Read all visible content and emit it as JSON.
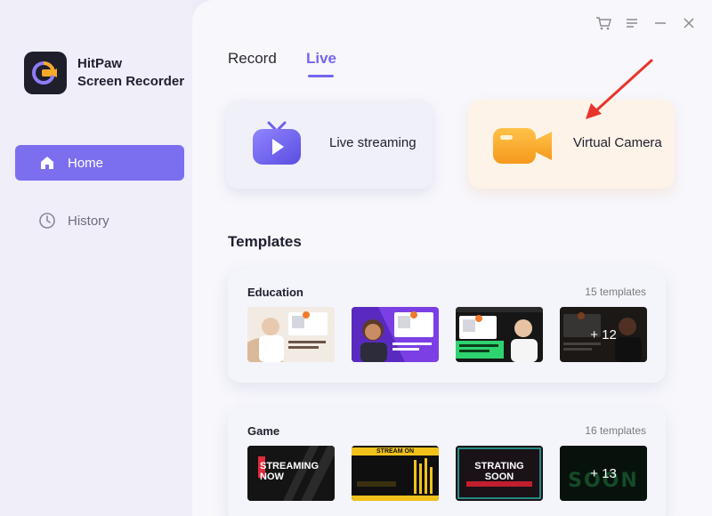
{
  "app": {
    "name_line1": "HitPaw",
    "name_line2": "Screen Recorder"
  },
  "sidebar": {
    "items": [
      {
        "label": "Home",
        "icon": "home-icon",
        "active": true
      },
      {
        "label": "History",
        "icon": "clock-icon",
        "active": false
      }
    ]
  },
  "tabs": [
    {
      "label": "Record",
      "active": false
    },
    {
      "label": "Live",
      "active": true
    }
  ],
  "modes": [
    {
      "label": "Live streaming",
      "icon": "tv-play-icon"
    },
    {
      "label": "Virtual Camera",
      "icon": "video-camera-icon"
    }
  ],
  "templates": {
    "title": "Templates",
    "categories": [
      {
        "name": "Education",
        "count": "15 templates",
        "thumbs": [
          {
            "caption": ""
          },
          {
            "caption": ""
          },
          {
            "caption": ""
          },
          {
            "caption": "+ 12"
          }
        ]
      },
      {
        "name": "Game",
        "count": "16 templates",
        "thumbs": [
          {
            "caption": "STREAMING NOW"
          },
          {
            "caption": "STREAM ON"
          },
          {
            "caption": "STRATING SOON"
          },
          {
            "caption": "+ 13"
          }
        ]
      }
    ]
  },
  "colors": {
    "accent": "#7366ee",
    "nav_active": "#7b6ff0",
    "virtual_card_bg": "#fdf3e8",
    "camera_orange": "#f5a623",
    "arrow_red": "#e8342b"
  }
}
